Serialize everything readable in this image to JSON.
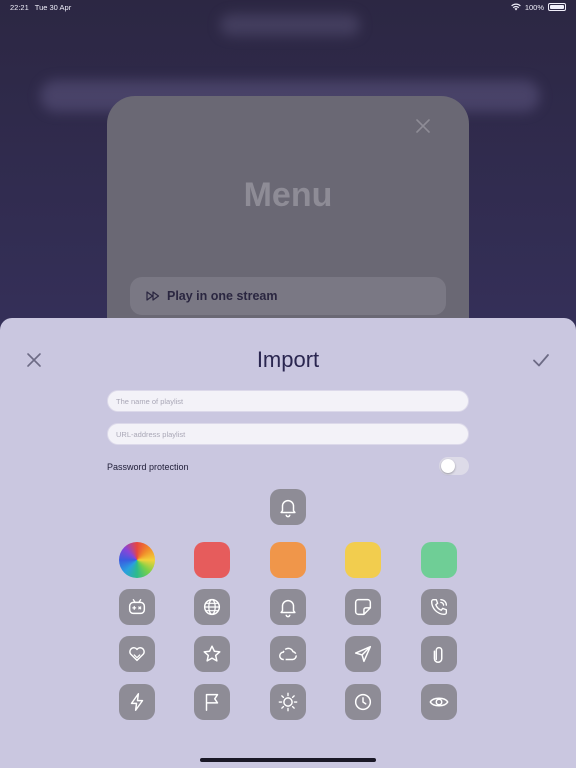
{
  "status": {
    "time": "22:21",
    "date": "Tue 30 Apr",
    "battery": "100%"
  },
  "menu": {
    "title": "Menu",
    "item_label": "Play in one stream"
  },
  "sheet": {
    "title": "Import",
    "name_placeholder": "The name of playlist",
    "url_placeholder": "URL-address playlist",
    "password_label": "Password protection",
    "password_enabled": false
  },
  "colors": {
    "swatches": [
      "#e65c5c",
      "#f0964a",
      "#f2cd4e",
      "#6fce96"
    ],
    "sheet_bg": "#cac7e0",
    "title_color": "#2a2650"
  },
  "icons": {
    "selected": "bell-icon",
    "grid": [
      "gamepad-icon",
      "globe-icon",
      "bell-icon",
      "note-icon",
      "phone-icon",
      "hearts-icon",
      "star-icon",
      "cloud-icon",
      "send-icon",
      "paperclip-icon",
      "lightning-icon",
      "flag-icon",
      "sun-icon",
      "clock-icon",
      "eye-icon"
    ]
  }
}
